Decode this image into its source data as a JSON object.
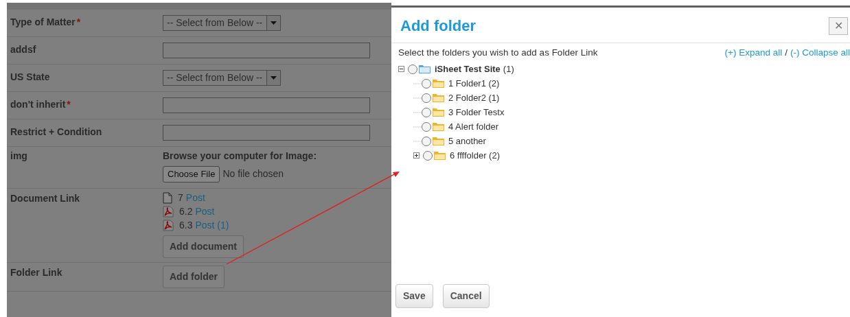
{
  "form": {
    "rows": [
      {
        "label": "Type of Matter",
        "required_mark": "*",
        "kind": "select",
        "value": "-- Select from Below --"
      },
      {
        "label": "addsf",
        "kind": "text"
      },
      {
        "label": "US State",
        "kind": "select",
        "value": "-- Select from Below --"
      },
      {
        "label": "don't inherit",
        "required_mark": "*",
        "kind": "text"
      },
      {
        "label": "Restrict + Condition",
        "kind": "text"
      },
      {
        "label": "img",
        "kind": "file",
        "prompt": "Browse your computer for Image:",
        "button": "Choose File",
        "status": "No file chosen"
      },
      {
        "label": "Document Link",
        "kind": "documents",
        "documents": [
          {
            "kind": "page",
            "number": "7",
            "link": "Post"
          },
          {
            "kind": "pdf",
            "number": "6.2",
            "link": "Post"
          },
          {
            "kind": "pdf",
            "number": "6.3",
            "link": "Post (1)"
          }
        ],
        "button": "Add document"
      },
      {
        "label": "Folder Link",
        "kind": "button",
        "button": "Add folder"
      }
    ]
  },
  "dialog": {
    "title": "Add folder",
    "close": "✕",
    "instruction": "Select the folders you wish to add as Folder Link",
    "expand_all": "(+) Expand all",
    "separator": "/",
    "collapse_all": "(-) Collapse all",
    "tree": [
      {
        "name": "iSheet Test Site",
        "count": "(1)",
        "kind": "site",
        "expanded": true,
        "selected": false,
        "children": [
          {
            "name": "1 Folder1 (2)",
            "kind": "folder",
            "selected": false
          },
          {
            "name": "2 Folder2 (1)",
            "kind": "folder",
            "selected": false
          },
          {
            "name": "3 Folder Testx",
            "kind": "folder",
            "selected": false
          },
          {
            "name": "4 Alert folder",
            "kind": "folder",
            "selected": false
          },
          {
            "name": "5 another",
            "kind": "folder",
            "selected": false
          },
          {
            "name": "6 ffffolder (2)",
            "kind": "folder",
            "expanded": false,
            "selected": false
          }
        ]
      }
    ],
    "buttons": [
      "Save",
      "Cancel"
    ]
  }
}
